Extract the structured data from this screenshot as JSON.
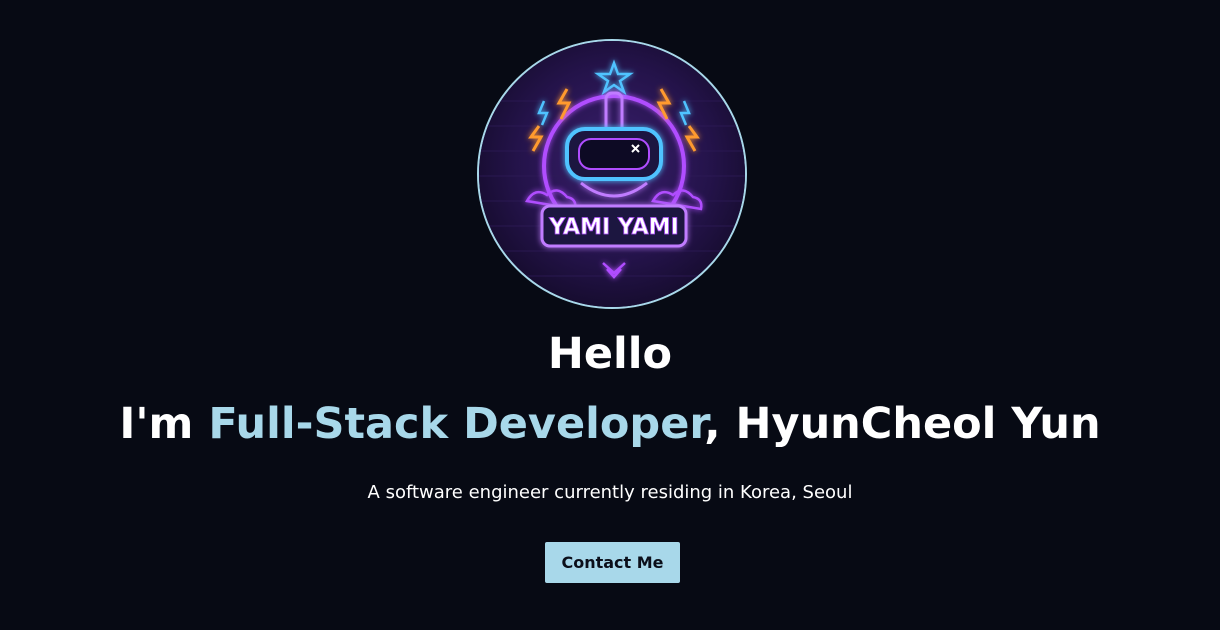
{
  "profile": {
    "avatar_alt": "Profile avatar",
    "logo_text": "YAMI YAMI"
  },
  "hero": {
    "greeting": "Hello",
    "headline_prefix": "I'm ",
    "headline_accent": "Full-Stack Developer",
    "headline_suffix": ", HyunCheol Yun",
    "subtitle": "A software engineer currently residing in Korea, Seoul",
    "contact_label": "Contact Me"
  },
  "colors": {
    "background": "#070a14",
    "accent": "#a8d8ea",
    "text": "#ffffff",
    "neon_purple": "#b04dff",
    "neon_blue": "#4fc3ff",
    "neon_orange": "#ff9a2e"
  }
}
